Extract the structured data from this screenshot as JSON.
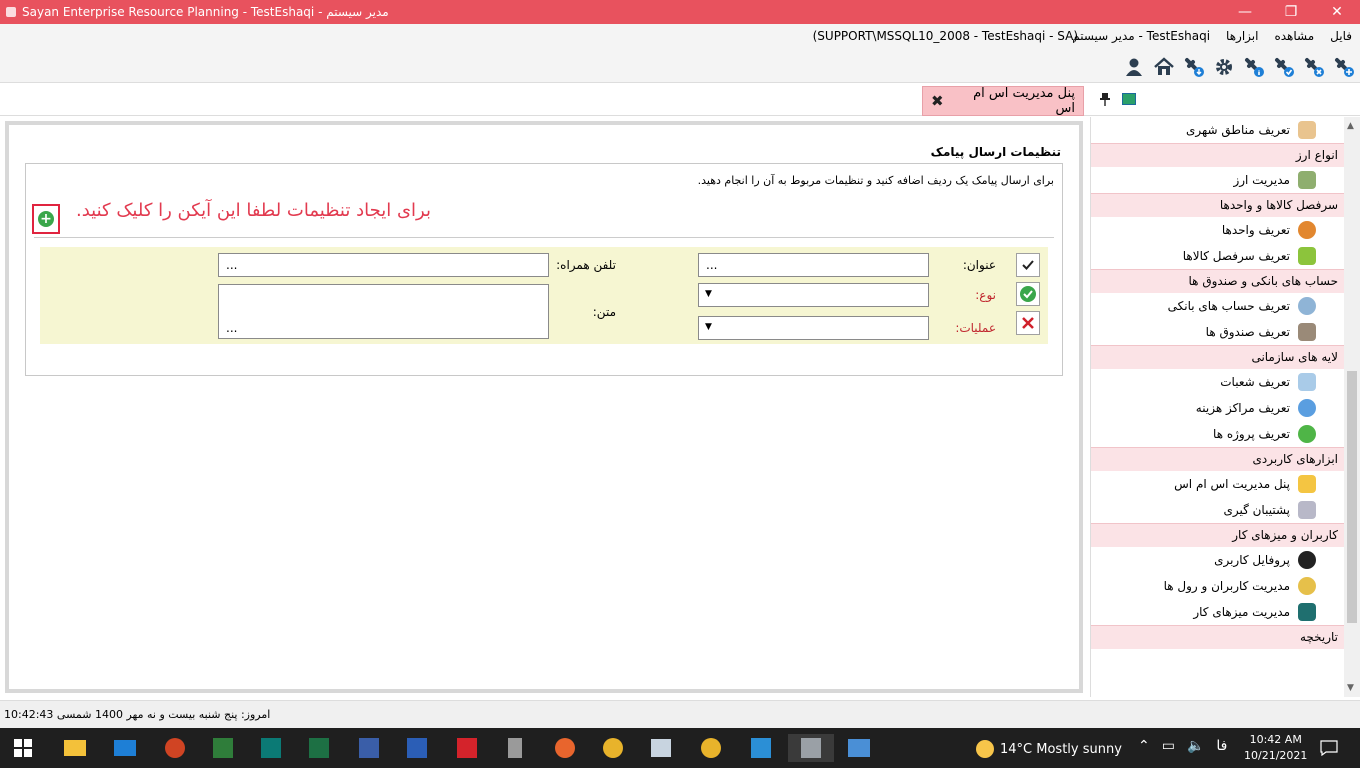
{
  "window": {
    "title": "Sayan Enterprise Resource Planning - TestEshaqi - مدیر سیستم",
    "controls": [
      "—",
      "❐",
      "✕"
    ]
  },
  "menubar": {
    "items": [
      "فایل",
      "مشاهده",
      "ابزارها",
      "TestEshaqi - مدیر سیستم"
    ],
    "connection": "(SUPPORT\\MSSQL10_2008 - TestEshaqi - SA)"
  },
  "toolbar": {
    "icons": [
      "user-icon",
      "home-icon",
      "plug-download-icon",
      "gear-icon",
      "plug-info-icon",
      "plug-check-icon",
      "plug-remove-icon",
      "plug-add-icon"
    ]
  },
  "tab": {
    "label": "پنل مدیریت اس ام اس",
    "close": "✖"
  },
  "main": {
    "section_title": "تنظیمات ارسال پیامک",
    "instruction": "برای ارسال پیامک یک ردیف اضافه کنید و تنظیمات مربوط به آن را انجام دهید.",
    "hint": "برای ایجاد تنظیمات لطفا این آیکن را کلیک کنید.",
    "form": {
      "title_label": "عنوان:",
      "title_value": "...",
      "phone_label": "تلفن همراه:",
      "phone_value": "...",
      "type_label": "نوع:",
      "ops_label": "عملیات:",
      "text_label": "متن:",
      "text_value": "..."
    }
  },
  "sidebar": {
    "top_item": "تعریف مناطق شهری",
    "groups": [
      {
        "title": "انواع ارز",
        "items": [
          "مدیریت ارز"
        ]
      },
      {
        "title": "سرفصل کالاها و واحدها",
        "items": [
          "تعریف واحدها",
          "تعریف سرفصل کالاها"
        ]
      },
      {
        "title": "حساب های بانکی و صندوق ها",
        "items": [
          "تعریف حساب های بانکی",
          "تعریف صندوق ها"
        ]
      },
      {
        "title": "لایه های سازمانی",
        "items": [
          "تعریف شعبات",
          "تعریف مراکز هزینه",
          "تعریف پروژه ها"
        ]
      },
      {
        "title": "ابزارهای کاربردی",
        "items": [
          "پنل مدیریت اس ام اس",
          "پشتیبان گیری"
        ]
      },
      {
        "title": "کاربران و میزهای کار",
        "items": [
          "پروفایل کاربری",
          "مدیریت کاربران و رول ها",
          "مدیریت میزهای کار"
        ]
      },
      {
        "title": "تاریخچه",
        "items": []
      }
    ]
  },
  "statusbar": {
    "text": "امروز: پنج شنبه بیست و نه مهر 1400  شمسی  10:42:43"
  },
  "taskbar": {
    "weather": "14°C  Mostly sunny",
    "lang": "فا",
    "time": "10:42 AM",
    "date": "10/21/2021"
  }
}
